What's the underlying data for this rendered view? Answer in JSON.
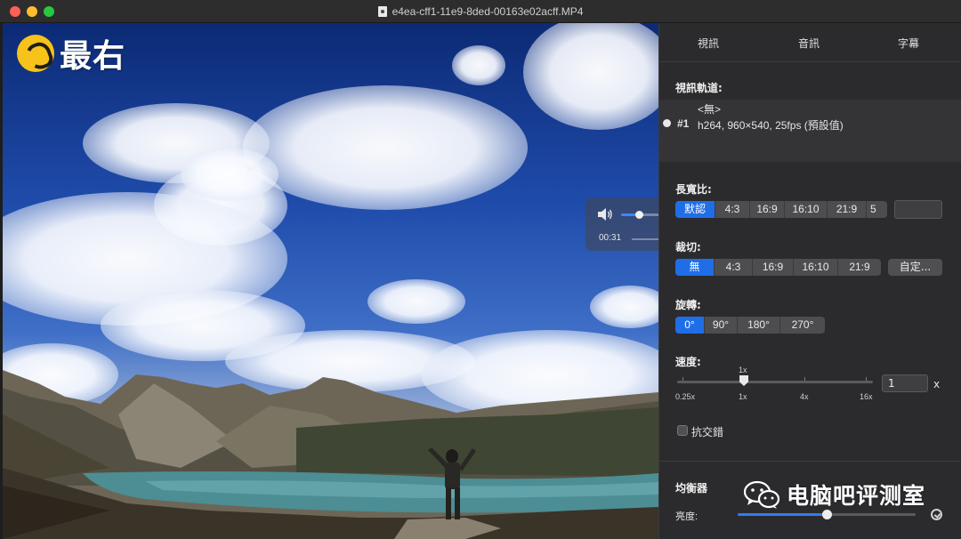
{
  "window": {
    "title": "e4ea-cff1-11e9-8ded-00163e02acff.MP4"
  },
  "overlay": {
    "logo_text": "最右",
    "current_time": "00:31",
    "volume_level": 0.45
  },
  "panel": {
    "tabs": [
      "視訊",
      "音訊",
      "字幕"
    ],
    "video_track": {
      "label": "視訊軌道:",
      "none_option": "<無>",
      "track_number": "#1",
      "track_info": "h264, 960×540, 25fps (預設值)"
    },
    "aspect": {
      "label": "長寬比:",
      "options": [
        "默認",
        "4:3",
        "16:9",
        "16:10",
        "21:9",
        "5"
      ],
      "selected": "默認"
    },
    "crop": {
      "label": "裁切:",
      "options": [
        "無",
        "4:3",
        "16:9",
        "16:10",
        "21:9"
      ],
      "selected": "無",
      "custom_label": "自定..."
    },
    "rotate": {
      "label": "旋轉:",
      "options": [
        "0°",
        "90°",
        "180°",
        "270°"
      ],
      "selected": "0°"
    },
    "speed": {
      "label": "速度:",
      "current_marker": "1x",
      "ticks": [
        "0.25x",
        "1x",
        "4x",
        "16x"
      ],
      "value": "1",
      "unit": "x"
    },
    "deinterlace": {
      "label": "抗交錯",
      "checked": false
    },
    "equalizer": {
      "label": "均衡器",
      "brightness_label": "亮度:",
      "brightness_level": 0.5
    }
  },
  "watermark": {
    "text": "电脑吧评测室"
  },
  "colors": {
    "accent": "#1f6ee8",
    "panel_bg": "#2b2b2d",
    "logo_yellow": "#f7c21a"
  }
}
